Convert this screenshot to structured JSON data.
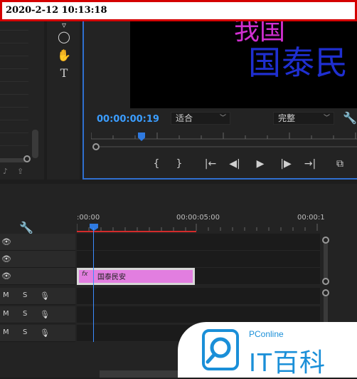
{
  "timestamp": "2020-2-12 10:13:18",
  "program_monitor": {
    "video_title_top": "我国",
    "video_title_main": "国泰民",
    "timecode": "00:00:00:19",
    "zoom_value": "适合",
    "quality_value": "完整"
  },
  "timeline": {
    "time_start": ":00:00",
    "time_mid": "00:00:05:00",
    "time_end": "00:00:1",
    "clip_fx": "fx",
    "clip_label": "国泰民安",
    "audio_tracks": [
      {
        "mute": "M",
        "solo": "S"
      },
      {
        "mute": "M",
        "solo": "S"
      },
      {
        "mute": "M",
        "solo": "S"
      }
    ]
  },
  "watermark": {
    "brand": "PConline",
    "main": "IT百科"
  },
  "colors": {
    "accent_blue": "#2f7ae0",
    "timecode_blue": "#3b9dff",
    "clip_pink": "#e27ee0",
    "inout_red": "#d22b2b",
    "watermark_blue": "#1a8fd8"
  }
}
